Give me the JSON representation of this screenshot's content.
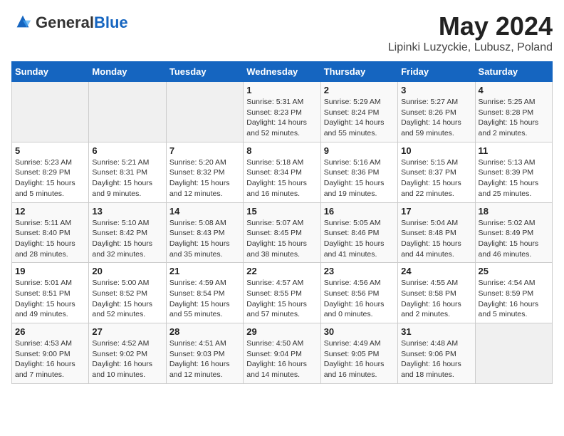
{
  "logo": {
    "general": "General",
    "blue": "Blue"
  },
  "header": {
    "month_year": "May 2024",
    "location": "Lipinki Luzyckie, Lubusz, Poland"
  },
  "weekdays": [
    "Sunday",
    "Monday",
    "Tuesday",
    "Wednesday",
    "Thursday",
    "Friday",
    "Saturday"
  ],
  "weeks": [
    [
      {
        "day": "",
        "info": ""
      },
      {
        "day": "",
        "info": ""
      },
      {
        "day": "",
        "info": ""
      },
      {
        "day": "1",
        "info": "Sunrise: 5:31 AM\nSunset: 8:23 PM\nDaylight: 14 hours\nand 52 minutes."
      },
      {
        "day": "2",
        "info": "Sunrise: 5:29 AM\nSunset: 8:24 PM\nDaylight: 14 hours\nand 55 minutes."
      },
      {
        "day": "3",
        "info": "Sunrise: 5:27 AM\nSunset: 8:26 PM\nDaylight: 14 hours\nand 59 minutes."
      },
      {
        "day": "4",
        "info": "Sunrise: 5:25 AM\nSunset: 8:28 PM\nDaylight: 15 hours\nand 2 minutes."
      }
    ],
    [
      {
        "day": "5",
        "info": "Sunrise: 5:23 AM\nSunset: 8:29 PM\nDaylight: 15 hours\nand 5 minutes."
      },
      {
        "day": "6",
        "info": "Sunrise: 5:21 AM\nSunset: 8:31 PM\nDaylight: 15 hours\nand 9 minutes."
      },
      {
        "day": "7",
        "info": "Sunrise: 5:20 AM\nSunset: 8:32 PM\nDaylight: 15 hours\nand 12 minutes."
      },
      {
        "day": "8",
        "info": "Sunrise: 5:18 AM\nSunset: 8:34 PM\nDaylight: 15 hours\nand 16 minutes."
      },
      {
        "day": "9",
        "info": "Sunrise: 5:16 AM\nSunset: 8:36 PM\nDaylight: 15 hours\nand 19 minutes."
      },
      {
        "day": "10",
        "info": "Sunrise: 5:15 AM\nSunset: 8:37 PM\nDaylight: 15 hours\nand 22 minutes."
      },
      {
        "day": "11",
        "info": "Sunrise: 5:13 AM\nSunset: 8:39 PM\nDaylight: 15 hours\nand 25 minutes."
      }
    ],
    [
      {
        "day": "12",
        "info": "Sunrise: 5:11 AM\nSunset: 8:40 PM\nDaylight: 15 hours\nand 28 minutes."
      },
      {
        "day": "13",
        "info": "Sunrise: 5:10 AM\nSunset: 8:42 PM\nDaylight: 15 hours\nand 32 minutes."
      },
      {
        "day": "14",
        "info": "Sunrise: 5:08 AM\nSunset: 8:43 PM\nDaylight: 15 hours\nand 35 minutes."
      },
      {
        "day": "15",
        "info": "Sunrise: 5:07 AM\nSunset: 8:45 PM\nDaylight: 15 hours\nand 38 minutes."
      },
      {
        "day": "16",
        "info": "Sunrise: 5:05 AM\nSunset: 8:46 PM\nDaylight: 15 hours\nand 41 minutes."
      },
      {
        "day": "17",
        "info": "Sunrise: 5:04 AM\nSunset: 8:48 PM\nDaylight: 15 hours\nand 44 minutes."
      },
      {
        "day": "18",
        "info": "Sunrise: 5:02 AM\nSunset: 8:49 PM\nDaylight: 15 hours\nand 46 minutes."
      }
    ],
    [
      {
        "day": "19",
        "info": "Sunrise: 5:01 AM\nSunset: 8:51 PM\nDaylight: 15 hours\nand 49 minutes."
      },
      {
        "day": "20",
        "info": "Sunrise: 5:00 AM\nSunset: 8:52 PM\nDaylight: 15 hours\nand 52 minutes."
      },
      {
        "day": "21",
        "info": "Sunrise: 4:59 AM\nSunset: 8:54 PM\nDaylight: 15 hours\nand 55 minutes."
      },
      {
        "day": "22",
        "info": "Sunrise: 4:57 AM\nSunset: 8:55 PM\nDaylight: 15 hours\nand 57 minutes."
      },
      {
        "day": "23",
        "info": "Sunrise: 4:56 AM\nSunset: 8:56 PM\nDaylight: 16 hours\nand 0 minutes."
      },
      {
        "day": "24",
        "info": "Sunrise: 4:55 AM\nSunset: 8:58 PM\nDaylight: 16 hours\nand 2 minutes."
      },
      {
        "day": "25",
        "info": "Sunrise: 4:54 AM\nSunset: 8:59 PM\nDaylight: 16 hours\nand 5 minutes."
      }
    ],
    [
      {
        "day": "26",
        "info": "Sunrise: 4:53 AM\nSunset: 9:00 PM\nDaylight: 16 hours\nand 7 minutes."
      },
      {
        "day": "27",
        "info": "Sunrise: 4:52 AM\nSunset: 9:02 PM\nDaylight: 16 hours\nand 10 minutes."
      },
      {
        "day": "28",
        "info": "Sunrise: 4:51 AM\nSunset: 9:03 PM\nDaylight: 16 hours\nand 12 minutes."
      },
      {
        "day": "29",
        "info": "Sunrise: 4:50 AM\nSunset: 9:04 PM\nDaylight: 16 hours\nand 14 minutes."
      },
      {
        "day": "30",
        "info": "Sunrise: 4:49 AM\nSunset: 9:05 PM\nDaylight: 16 hours\nand 16 minutes."
      },
      {
        "day": "31",
        "info": "Sunrise: 4:48 AM\nSunset: 9:06 PM\nDaylight: 16 hours\nand 18 minutes."
      },
      {
        "day": "",
        "info": ""
      }
    ]
  ]
}
